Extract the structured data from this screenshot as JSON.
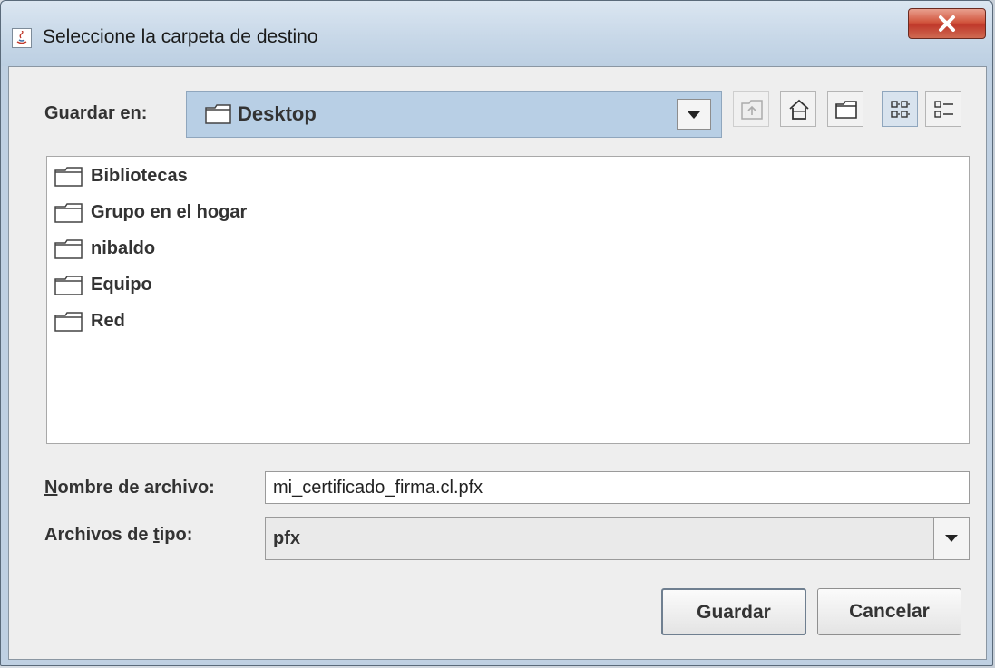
{
  "window": {
    "title": "Seleccione la carpeta de destino",
    "app_icon": "java-icon",
    "close_icon": "close-icon"
  },
  "toolbar": {
    "look_in_label_prefix": "Guardar en:",
    "look_in_value": "Desktop",
    "buttons": [
      "up-one-level-icon",
      "home-icon",
      "new-folder-icon",
      "list-view-icon",
      "details-view-icon"
    ]
  },
  "file_list": {
    "items": [
      {
        "name": "Bibliotecas",
        "icon": "folder-icon"
      },
      {
        "name": "Grupo en el hogar",
        "icon": "folder-icon"
      },
      {
        "name": "nibaldo",
        "icon": "folder-icon"
      },
      {
        "name": "Equipo",
        "icon": "folder-icon"
      },
      {
        "name": "Red",
        "icon": "folder-icon"
      }
    ]
  },
  "form": {
    "file_name_label_mnemonic": "N",
    "file_name_label_rest": "ombre de archivo:",
    "file_name_value": "mi_certificado_firma.cl.pfx",
    "file_type_label_pre": "Archivos de ",
    "file_type_label_mnemonic": "t",
    "file_type_label_post": "ipo:",
    "file_type_value": "pfx"
  },
  "actions": {
    "save_label": "Guardar",
    "cancel_label": "Cancelar"
  },
  "colors": {
    "title_bar": "#c8d8e8",
    "close_button": "#c0392b",
    "combo_selected": "#b8cfe5",
    "dialog_body": "#eeeeee"
  }
}
